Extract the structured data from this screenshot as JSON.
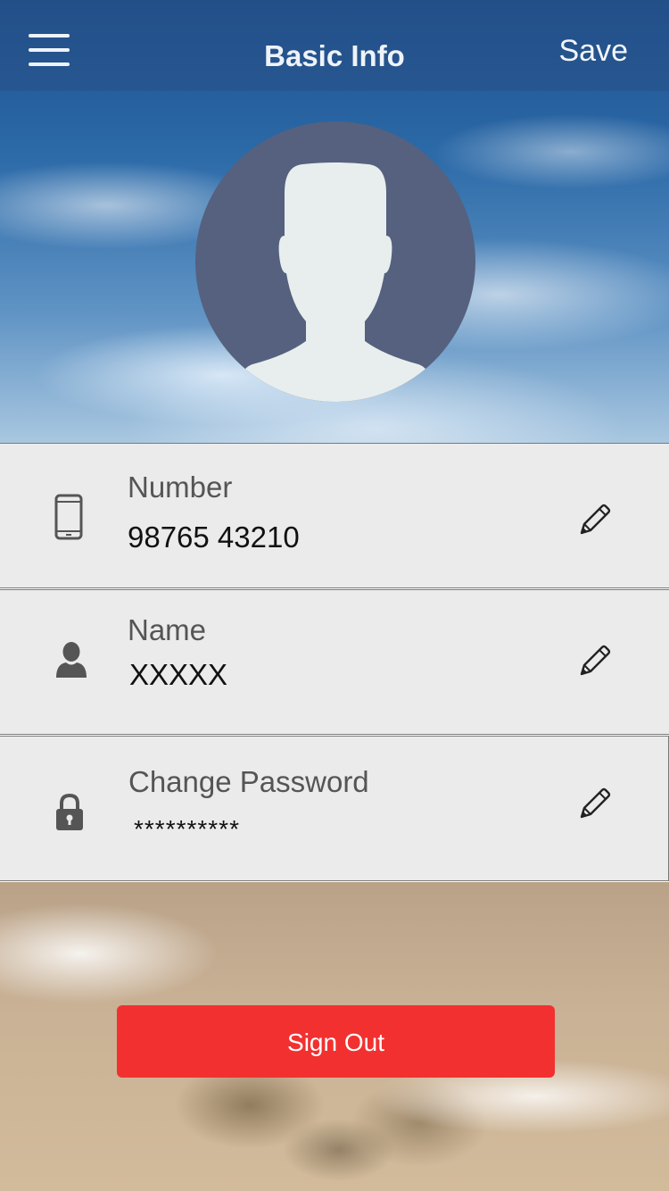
{
  "header": {
    "title": "Basic Info",
    "save_label": "Save"
  },
  "profile": {
    "avatar_icon": "default-user-silhouette"
  },
  "fields": [
    {
      "icon": "mobile-phone-icon",
      "label": "Number",
      "value": "98765 43210",
      "edit_icon": "pencil-icon"
    },
    {
      "icon": "user-icon",
      "label": "Name",
      "value": "XXXXX",
      "edit_icon": "pencil-icon"
    },
    {
      "icon": "lock-icon",
      "label": "Change Password",
      "value": "**********",
      "edit_icon": "pencil-icon"
    }
  ],
  "actions": {
    "sign_out_label": "Sign Out"
  },
  "colors": {
    "header_text": "#eef3f8",
    "row_background": "#ebebeb",
    "sign_out_button": "#f23030"
  }
}
